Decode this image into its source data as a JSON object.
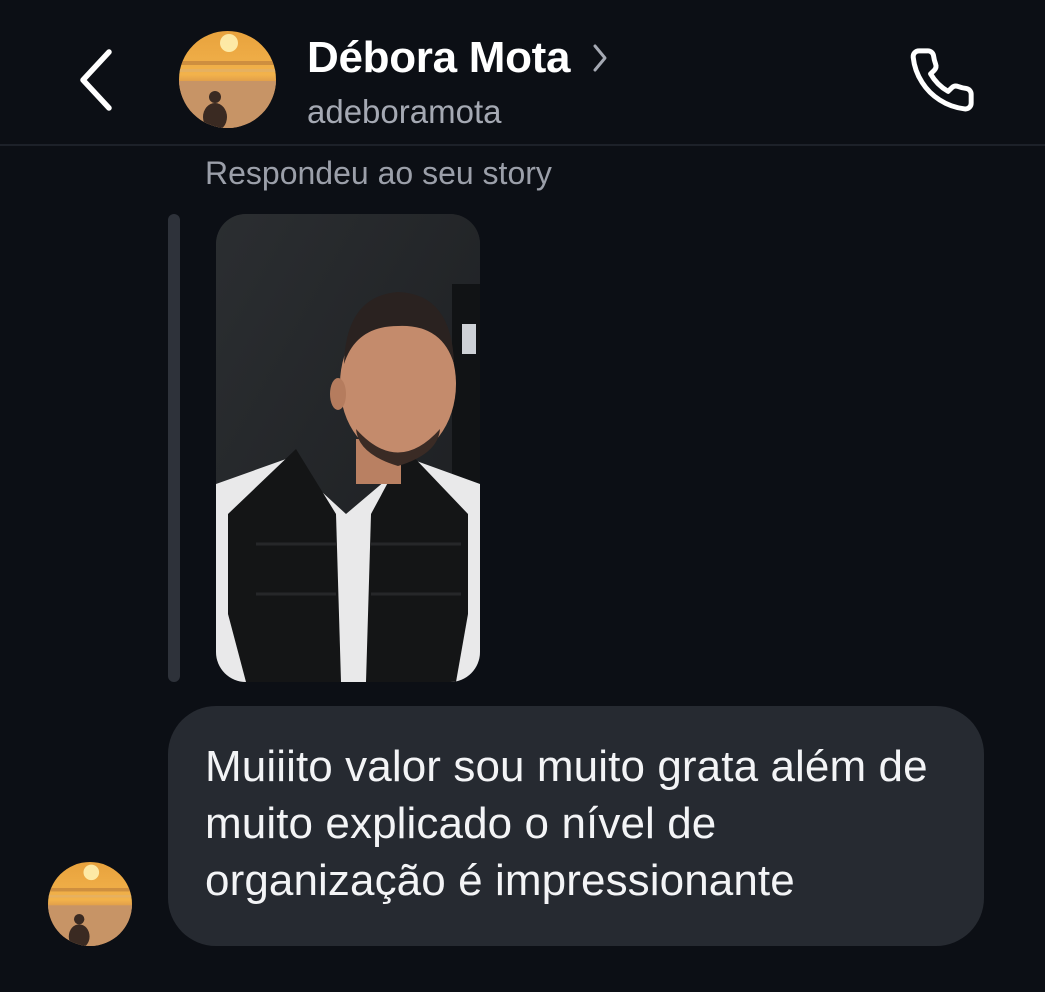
{
  "header": {
    "contact_name": "Débora Mota",
    "handle": "adeboramota",
    "back_icon": "chevron-left-icon",
    "name_chevron_icon": "chevron-right-icon",
    "call_icon": "phone-icon"
  },
  "story_reply": {
    "caption": "Respondeu ao seu story"
  },
  "message": {
    "text": "Muiiito valor sou muito grata além de muito explicado o nível de organização é impressionante"
  },
  "colors": {
    "background": "#0c0f15",
    "bubble": "#262a31",
    "secondary_text": "#a5a9b3"
  }
}
